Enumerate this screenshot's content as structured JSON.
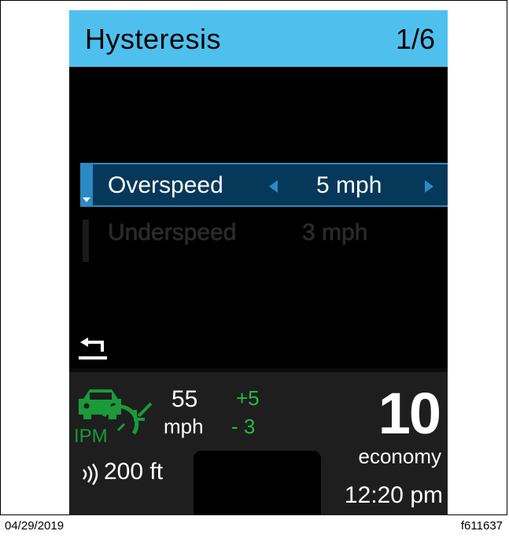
{
  "header": {
    "title": "Hysteresis",
    "page": "1/6"
  },
  "settings": [
    {
      "label": "Overspeed",
      "value": "5  mph",
      "selected": true
    },
    {
      "label": "Underspeed",
      "value": "3  mph",
      "selected": false
    }
  ],
  "status": {
    "ipm_label": "IPM",
    "set_speed": "55",
    "speed_unit": "mph",
    "over_offset": "+5",
    "under_offset": "- 3",
    "distance": "200 ft",
    "gear": "10",
    "mode": "economy",
    "time": "12:20 pm"
  },
  "footer": {
    "date": "04/29/2019",
    "code": "f611637"
  },
  "colors": {
    "header_bg": "#4fc0ee",
    "selection_bg": "#06385a",
    "accent": "#2a8bc4",
    "offset_green": "#22bb44",
    "ipm_green": "#1a9a3a"
  },
  "icons": {
    "back": "back-arrow-icon",
    "ipm": "cruise-ipm-icon",
    "radar": "radar-signal-icon"
  }
}
